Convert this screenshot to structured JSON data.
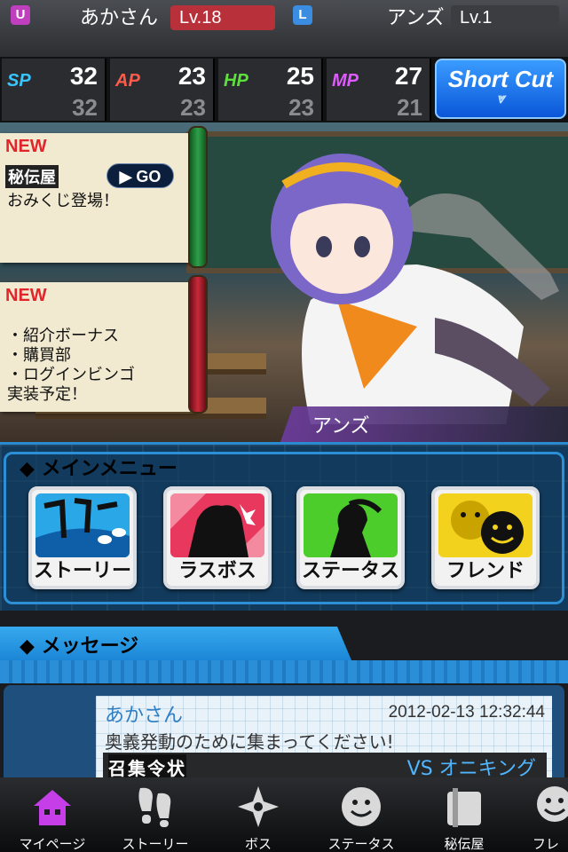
{
  "user": {
    "badge": "U",
    "name": "あかさん",
    "level": "Lv.18"
  },
  "leader": {
    "badge": "L",
    "name": "アンズ",
    "level": "Lv.1"
  },
  "stats": [
    {
      "label": "SP",
      "current": "32",
      "max": "32",
      "color": "#39c6ff"
    },
    {
      "label": "AP",
      "current": "23",
      "max": "23",
      "color": "#ff5a4a"
    },
    {
      "label": "HP",
      "current": "25",
      "max": "23",
      "color": "#5de03e"
    },
    {
      "label": "MP",
      "current": "27",
      "max": "21",
      "color": "#e05aff"
    }
  ],
  "shortcut": {
    "label": "Short Cut"
  },
  "notices": [
    {
      "new_badge": "NEW",
      "tag": "秘伝屋",
      "text": "おみくじ登場！",
      "go": "GO"
    },
    {
      "new_badge": "NEW",
      "lines": [
        "・紹介ボーナス",
        "・購買部",
        "・ログインビンゴ",
        "実装予定！"
      ]
    }
  ],
  "character": {
    "name": "アンズ"
  },
  "main_menu": {
    "title": "メインメニュー",
    "buttons": [
      {
        "label": "ストーリー",
        "art": "story-art-icon"
      },
      {
        "label": "ラスボス",
        "art": "last-boss-art-icon"
      },
      {
        "label": "ステータス",
        "art": "status-art-icon"
      },
      {
        "label": "フレンド",
        "art": "friend-art-icon"
      }
    ]
  },
  "messages": {
    "title": "メッセージ",
    "items": [
      {
        "sender": "あかさん",
        "timestamp": "2012-02-13 12:32:44",
        "body": "奥義発動のために集まってください!",
        "label": "召集令状",
        "vs": "VS オニキング"
      }
    ]
  },
  "tabs": [
    {
      "label": "マイページ",
      "icon": "home-icon",
      "active": true
    },
    {
      "label": "ストーリー",
      "icon": "footprints-icon"
    },
    {
      "label": "ボス",
      "icon": "shuriken-icon"
    },
    {
      "label": "ステータス",
      "icon": "smiley-icon"
    },
    {
      "label": "秘伝屋",
      "icon": "scroll-box-icon"
    },
    {
      "label": "フレ",
      "icon": "friends-icon"
    }
  ],
  "colors": {
    "accent": "#2b8bd0",
    "active_tab": "#c63ee8",
    "new_badge": "#e0262b"
  }
}
